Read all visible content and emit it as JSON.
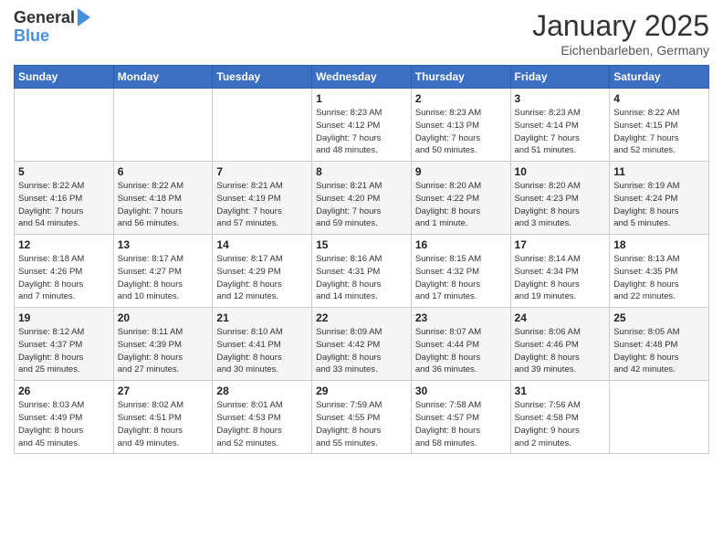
{
  "header": {
    "logo_line1": "General",
    "logo_line2": "Blue",
    "month": "January 2025",
    "location": "Eichenbarleben, Germany"
  },
  "weekdays": [
    "Sunday",
    "Monday",
    "Tuesday",
    "Wednesday",
    "Thursday",
    "Friday",
    "Saturday"
  ],
  "weeks": [
    [
      {
        "day": "",
        "info": ""
      },
      {
        "day": "",
        "info": ""
      },
      {
        "day": "",
        "info": ""
      },
      {
        "day": "1",
        "info": "Sunrise: 8:23 AM\nSunset: 4:12 PM\nDaylight: 7 hours\nand 48 minutes."
      },
      {
        "day": "2",
        "info": "Sunrise: 8:23 AM\nSunset: 4:13 PM\nDaylight: 7 hours\nand 50 minutes."
      },
      {
        "day": "3",
        "info": "Sunrise: 8:23 AM\nSunset: 4:14 PM\nDaylight: 7 hours\nand 51 minutes."
      },
      {
        "day": "4",
        "info": "Sunrise: 8:22 AM\nSunset: 4:15 PM\nDaylight: 7 hours\nand 52 minutes."
      }
    ],
    [
      {
        "day": "5",
        "info": "Sunrise: 8:22 AM\nSunset: 4:16 PM\nDaylight: 7 hours\nand 54 minutes."
      },
      {
        "day": "6",
        "info": "Sunrise: 8:22 AM\nSunset: 4:18 PM\nDaylight: 7 hours\nand 56 minutes."
      },
      {
        "day": "7",
        "info": "Sunrise: 8:21 AM\nSunset: 4:19 PM\nDaylight: 7 hours\nand 57 minutes."
      },
      {
        "day": "8",
        "info": "Sunrise: 8:21 AM\nSunset: 4:20 PM\nDaylight: 7 hours\nand 59 minutes."
      },
      {
        "day": "9",
        "info": "Sunrise: 8:20 AM\nSunset: 4:22 PM\nDaylight: 8 hours\nand 1 minute."
      },
      {
        "day": "10",
        "info": "Sunrise: 8:20 AM\nSunset: 4:23 PM\nDaylight: 8 hours\nand 3 minutes."
      },
      {
        "day": "11",
        "info": "Sunrise: 8:19 AM\nSunset: 4:24 PM\nDaylight: 8 hours\nand 5 minutes."
      }
    ],
    [
      {
        "day": "12",
        "info": "Sunrise: 8:18 AM\nSunset: 4:26 PM\nDaylight: 8 hours\nand 7 minutes."
      },
      {
        "day": "13",
        "info": "Sunrise: 8:17 AM\nSunset: 4:27 PM\nDaylight: 8 hours\nand 10 minutes."
      },
      {
        "day": "14",
        "info": "Sunrise: 8:17 AM\nSunset: 4:29 PM\nDaylight: 8 hours\nand 12 minutes."
      },
      {
        "day": "15",
        "info": "Sunrise: 8:16 AM\nSunset: 4:31 PM\nDaylight: 8 hours\nand 14 minutes."
      },
      {
        "day": "16",
        "info": "Sunrise: 8:15 AM\nSunset: 4:32 PM\nDaylight: 8 hours\nand 17 minutes."
      },
      {
        "day": "17",
        "info": "Sunrise: 8:14 AM\nSunset: 4:34 PM\nDaylight: 8 hours\nand 19 minutes."
      },
      {
        "day": "18",
        "info": "Sunrise: 8:13 AM\nSunset: 4:35 PM\nDaylight: 8 hours\nand 22 minutes."
      }
    ],
    [
      {
        "day": "19",
        "info": "Sunrise: 8:12 AM\nSunset: 4:37 PM\nDaylight: 8 hours\nand 25 minutes."
      },
      {
        "day": "20",
        "info": "Sunrise: 8:11 AM\nSunset: 4:39 PM\nDaylight: 8 hours\nand 27 minutes."
      },
      {
        "day": "21",
        "info": "Sunrise: 8:10 AM\nSunset: 4:41 PM\nDaylight: 8 hours\nand 30 minutes."
      },
      {
        "day": "22",
        "info": "Sunrise: 8:09 AM\nSunset: 4:42 PM\nDaylight: 8 hours\nand 33 minutes."
      },
      {
        "day": "23",
        "info": "Sunrise: 8:07 AM\nSunset: 4:44 PM\nDaylight: 8 hours\nand 36 minutes."
      },
      {
        "day": "24",
        "info": "Sunrise: 8:06 AM\nSunset: 4:46 PM\nDaylight: 8 hours\nand 39 minutes."
      },
      {
        "day": "25",
        "info": "Sunrise: 8:05 AM\nSunset: 4:48 PM\nDaylight: 8 hours\nand 42 minutes."
      }
    ],
    [
      {
        "day": "26",
        "info": "Sunrise: 8:03 AM\nSunset: 4:49 PM\nDaylight: 8 hours\nand 45 minutes."
      },
      {
        "day": "27",
        "info": "Sunrise: 8:02 AM\nSunset: 4:51 PM\nDaylight: 8 hours\nand 49 minutes."
      },
      {
        "day": "28",
        "info": "Sunrise: 8:01 AM\nSunset: 4:53 PM\nDaylight: 8 hours\nand 52 minutes."
      },
      {
        "day": "29",
        "info": "Sunrise: 7:59 AM\nSunset: 4:55 PM\nDaylight: 8 hours\nand 55 minutes."
      },
      {
        "day": "30",
        "info": "Sunrise: 7:58 AM\nSunset: 4:57 PM\nDaylight: 8 hours\nand 58 minutes."
      },
      {
        "day": "31",
        "info": "Sunrise: 7:56 AM\nSunset: 4:58 PM\nDaylight: 9 hours\nand 2 minutes."
      },
      {
        "day": "",
        "info": ""
      }
    ]
  ]
}
